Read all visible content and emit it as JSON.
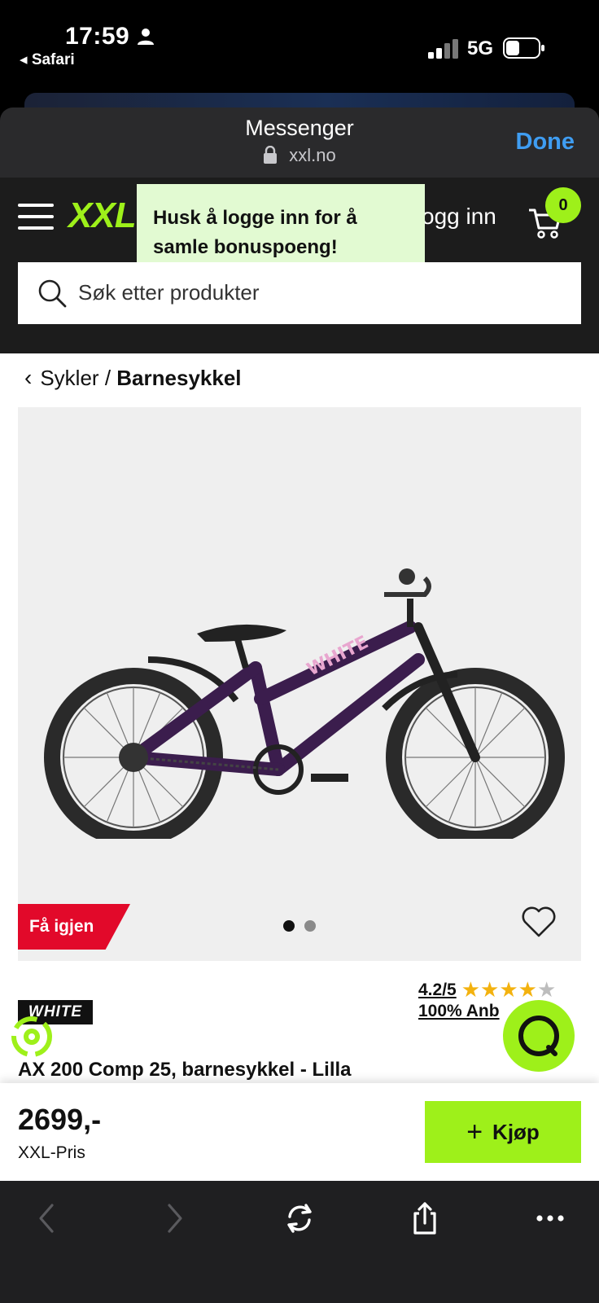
{
  "status_bar": {
    "time": "17:59",
    "back_app": "◂ Safari",
    "network": "5G"
  },
  "sheet": {
    "title": "Messenger",
    "url": "xxl.no",
    "done_label": "Done"
  },
  "header": {
    "logo": "XXL",
    "login_label": "ogg inn",
    "cart_count": "0",
    "tooltip_text": "Husk å logge inn for å samle bonuspoeng!",
    "search_placeholder": "Søk etter produkter"
  },
  "breadcrumb": {
    "parent": "Sykler",
    "separator": "/",
    "current": "Barnesykkel"
  },
  "product": {
    "badge": "Få igjen",
    "brand": "WHITE",
    "rating": "4.2/5",
    "rating_stars": 4.2,
    "recommend": "100% Anb",
    "title": "AX 200 Comp 25, barnesykkel - Lilla",
    "image_dots": 2,
    "active_dot": 0
  },
  "buy": {
    "price": "2699,-",
    "price_label": "XXL-Pris",
    "button_label": "Kjøp"
  },
  "colors": {
    "accent": "#9ef01a",
    "badge_red": "#e2092a",
    "link_blue": "#3f9df2",
    "bike_purple": "#3b1d4d"
  }
}
